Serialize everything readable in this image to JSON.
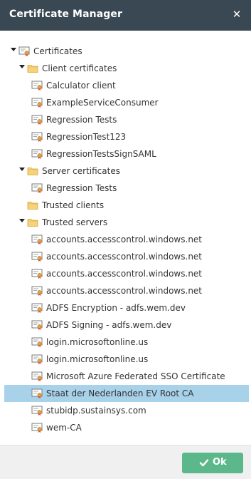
{
  "dialog": {
    "title": "Certificate Manager",
    "close_icon": "close-icon"
  },
  "tree": [
    {
      "level": 0,
      "type": "folder-cert",
      "expanded": true,
      "label": "Certificates"
    },
    {
      "level": 1,
      "type": "folder",
      "expanded": true,
      "label": "Client certificates"
    },
    {
      "level": 2,
      "type": "cert",
      "label": "Calculator client"
    },
    {
      "level": 2,
      "type": "cert",
      "label": "ExampleServiceConsumer"
    },
    {
      "level": 2,
      "type": "cert",
      "label": "Regression Tests"
    },
    {
      "level": 2,
      "type": "cert",
      "label": "RegressionTest123"
    },
    {
      "level": 2,
      "type": "cert",
      "label": "RegressionTestsSignSAML"
    },
    {
      "level": 1,
      "type": "folder",
      "expanded": true,
      "label": "Server certificates"
    },
    {
      "level": 2,
      "type": "cert",
      "label": "Regression Tests"
    },
    {
      "level": 1,
      "type": "folder",
      "expanded": false,
      "label": "Trusted clients"
    },
    {
      "level": 1,
      "type": "folder",
      "expanded": true,
      "label": "Trusted servers"
    },
    {
      "level": 2,
      "type": "cert",
      "label": "accounts.accesscontrol.windows.net"
    },
    {
      "level": 2,
      "type": "cert",
      "label": "accounts.accesscontrol.windows.net"
    },
    {
      "level": 2,
      "type": "cert",
      "label": "accounts.accesscontrol.windows.net"
    },
    {
      "level": 2,
      "type": "cert",
      "label": "accounts.accesscontrol.windows.net"
    },
    {
      "level": 2,
      "type": "cert",
      "label": "ADFS Encryption - adfs.wem.dev"
    },
    {
      "level": 2,
      "type": "cert",
      "label": "ADFS Signing - adfs.wem.dev"
    },
    {
      "level": 2,
      "type": "cert",
      "label": "login.microsoftonline.us"
    },
    {
      "level": 2,
      "type": "cert",
      "label": "login.microsoftonline.us"
    },
    {
      "level": 2,
      "type": "cert",
      "label": "Microsoft Azure Federated SSO Certificate"
    },
    {
      "level": 2,
      "type": "cert",
      "label": "Staat der Nederlanden EV Root CA",
      "selected": true
    },
    {
      "level": 2,
      "type": "cert",
      "label": "stubidp.sustainsys.com"
    },
    {
      "level": 2,
      "type": "cert",
      "label": "wem-CA"
    }
  ],
  "footer": {
    "ok_label": "Ok",
    "ok_icon": "check-icon"
  },
  "colors": {
    "titlebar": "#394852",
    "selected": "#a8d2ea",
    "ok": "#5cb88a",
    "folder": "#f2c46a"
  }
}
